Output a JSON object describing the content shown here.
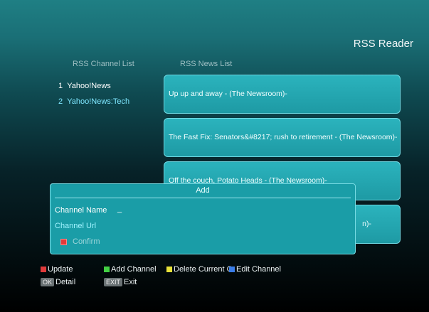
{
  "app_title": "RSS Reader",
  "channel_header": "RSS Channel List",
  "news_header": "RSS News List",
  "channels": [
    {
      "num": "1",
      "name": "Yahoo!News",
      "color": "#ffffff"
    },
    {
      "num": "2",
      "name": "Yahoo!News:Tech",
      "color": "#7fe7ff"
    }
  ],
  "news": [
    "Up up and away -     (The Newsroom)-",
    "The Fast Fix: Senators&#8217; rush to retirement -     (The Newsroom)-",
    "Off the couch, Potato Heads -     (The Newsroom)-",
    "n)-"
  ],
  "dialog": {
    "title": "Add",
    "name_label": "Channel Name",
    "name_value": "_",
    "url_label": "Channel Url",
    "confirm_label": "Confirm"
  },
  "legend": {
    "update": "Update",
    "add": "Add Channel",
    "delete": "Delete Current C",
    "edit": "Edit Channel",
    "ok_key": "OK",
    "ok_label": "Detail",
    "exit_key": "EXIT",
    "exit_label": "Exit"
  },
  "colors": {
    "red": "#e03a3a",
    "green": "#43d043",
    "yellow": "#e8e23a",
    "blue": "#3a7de8"
  }
}
